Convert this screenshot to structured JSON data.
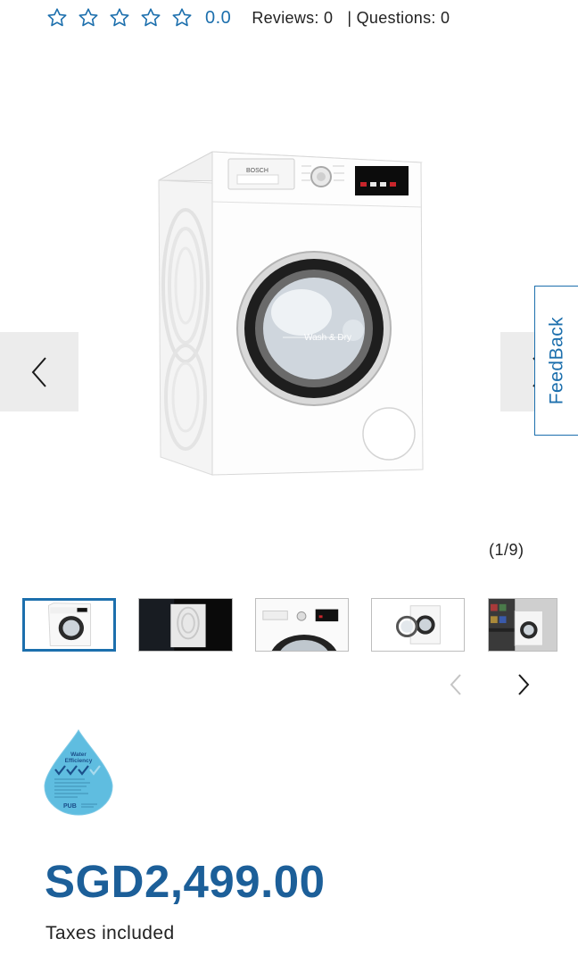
{
  "rating": {
    "stars_filled": 0,
    "stars_total": 5,
    "value": "0.0",
    "reviews_label": "Reviews: 0",
    "questions_label": "| Questions: 0"
  },
  "gallery": {
    "main_image_text": "Wash & Dry",
    "brand_label": "BOSCH",
    "counter": "(1/9)",
    "thumbnails": [
      {
        "name": "front-view",
        "active": true
      },
      {
        "name": "side-panel-dark",
        "active": false
      },
      {
        "name": "control-panel-closeup",
        "active": false
      },
      {
        "name": "open-door-view",
        "active": false
      },
      {
        "name": "laundry-room-scene",
        "active": false
      }
    ]
  },
  "feedback": {
    "label": "FeedBack"
  },
  "badge": {
    "title": "Water Efficiency",
    "ticks": 3,
    "org": "PUB"
  },
  "pricing": {
    "price": "SGD2,499.00",
    "taxes": "Taxes included"
  },
  "colors": {
    "accent": "#1c6fad",
    "price": "#1c5f99",
    "nav_bg": "#ececec",
    "badge_water": "#5fbde0"
  }
}
